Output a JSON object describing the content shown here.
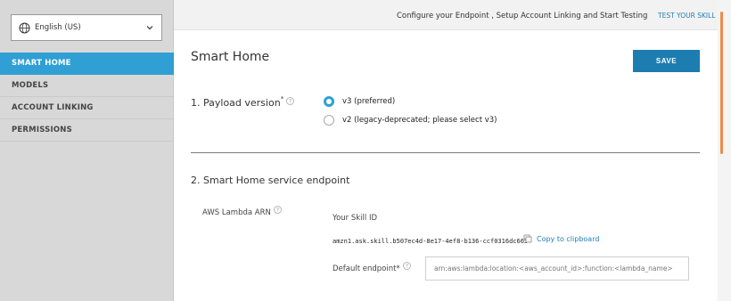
{
  "sidebar": {
    "language": "English (US)",
    "items": [
      {
        "label": "SMART HOME",
        "active": true
      },
      {
        "label": "MODELS",
        "active": false
      },
      {
        "label": "ACCOUNT LINKING",
        "active": false
      },
      {
        "label": "PERMISSIONS",
        "active": false
      }
    ]
  },
  "topbar": {
    "text": "Configure your Endpoint , Setup Account Linking and Start Testing",
    "test_link": "TEST YOUR SKILL"
  },
  "main": {
    "title": "Smart Home",
    "save_label": "SAVE",
    "payload": {
      "label": "1. Payload version",
      "required_mark": "*",
      "options": [
        {
          "label": "v3 (preferred)",
          "checked": true
        },
        {
          "label": "v2 (legacy-deprecated; please select v3)",
          "checked": false
        }
      ]
    },
    "endpoint": {
      "label": "2. Smart Home service endpoint",
      "lambda_label": "AWS Lambda ARN",
      "skill_id_label": "Your Skill ID",
      "skill_id": "amzn1.ask.skill.b507ec4d-8e17-4ef8-b136-ccf0316dc663",
      "copy_label": "Copy to clipboard",
      "default_label": "Default endpoint*",
      "default_placeholder": "arn:aws:lambda:location:<aws_account_id>:function:<lambda_name>"
    }
  },
  "colors": {
    "accent": "#2f9fd4",
    "save_button": "#1d7db0",
    "link": "#1f7fb6",
    "scroll_thumb": "#f0894a"
  },
  "icons": [
    "globe-icon",
    "chevron-down-icon",
    "help-icon",
    "copy-icon"
  ]
}
